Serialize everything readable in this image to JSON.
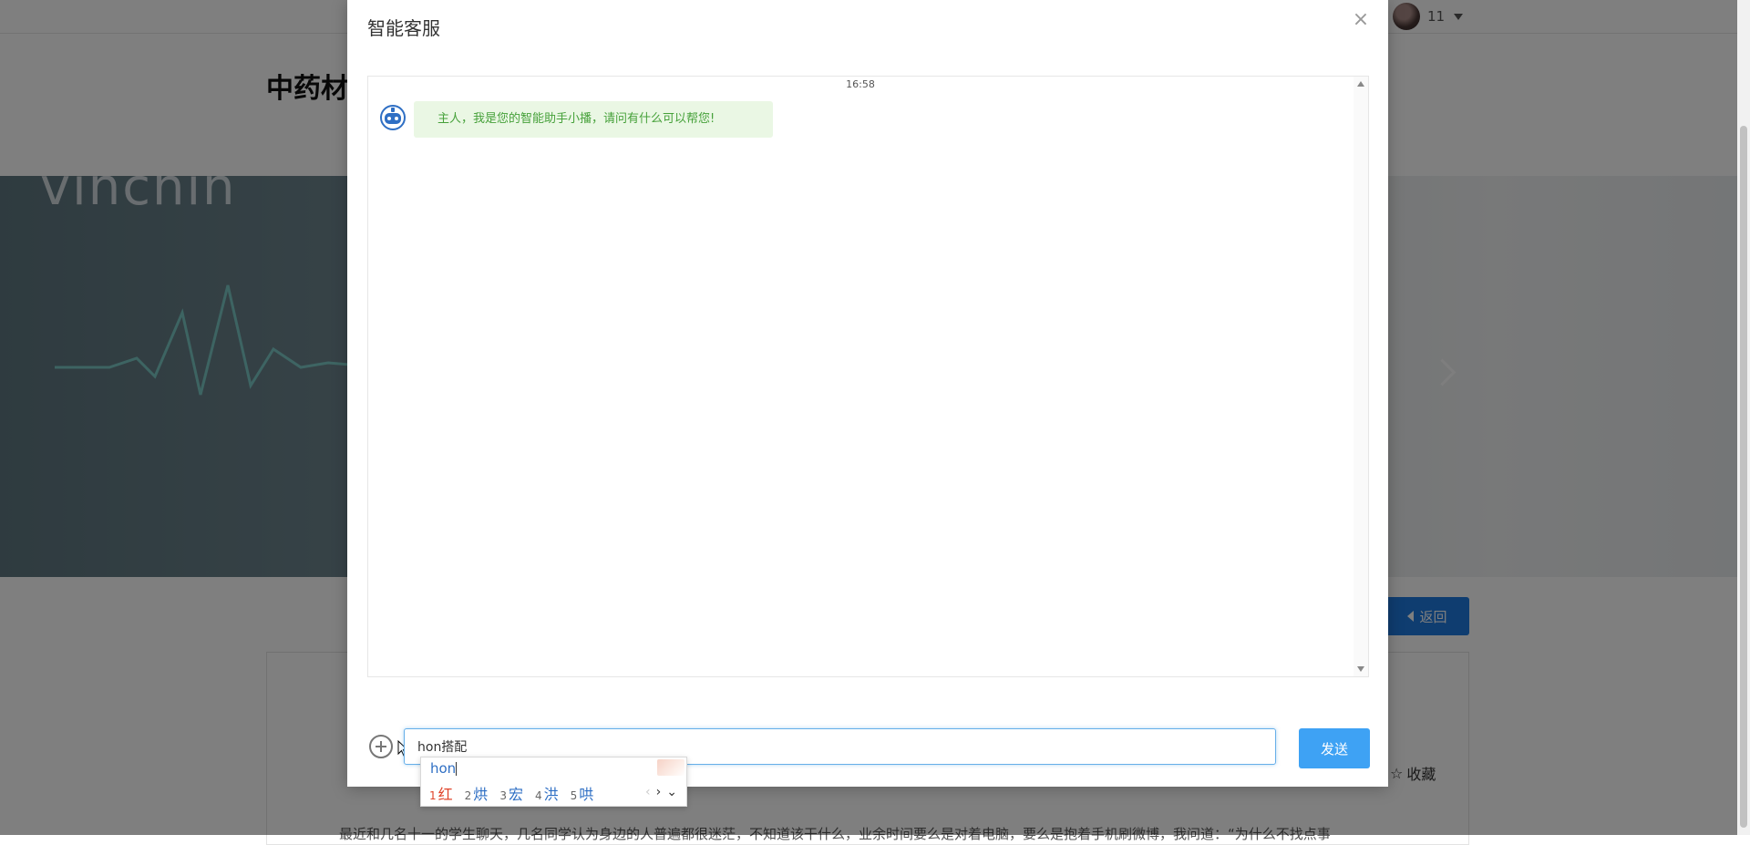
{
  "user": {
    "name": "11"
  },
  "page": {
    "title": "中药材",
    "banner_text": "vinchin",
    "back_label": "返回",
    "collect_label": "收藏",
    "article_snippet": "最近和几名十一的学生聊天，几名同学认为身边的人普遍都很迷茫，不知道该干什么，业余时间要么是对着电脑，要么是抱着手机刷微博，我问道：“为什么不找点事"
  },
  "modal": {
    "title": "智能客服",
    "close_symbol": "×",
    "chat": {
      "time": "16:58",
      "messages": [
        {
          "from": "bot",
          "text": "主人，我是您的智能助手小播，请问有什么可以帮您!"
        }
      ]
    },
    "input_value": "hon搭配",
    "send_label": "发送"
  },
  "ime": {
    "composition": "hon",
    "candidates": [
      {
        "num": "1",
        "char": "红"
      },
      {
        "num": "2",
        "char": "烘"
      },
      {
        "num": "3",
        "char": "宏"
      },
      {
        "num": "4",
        "char": "洪"
      },
      {
        "num": "5",
        "char": "哄"
      }
    ],
    "nav_prev": "‹",
    "nav_next": "›",
    "nav_more": "⌄"
  }
}
